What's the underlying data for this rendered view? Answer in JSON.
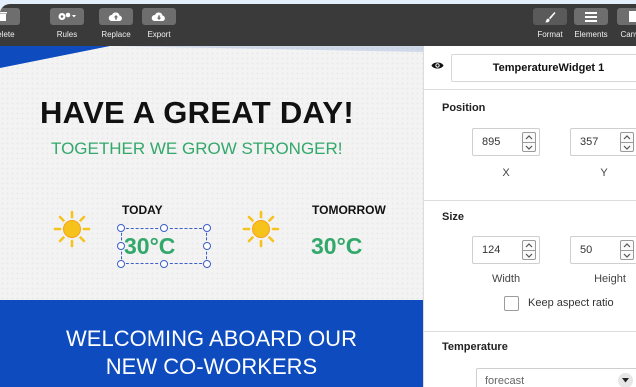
{
  "toolbar": {
    "left_buttons": [
      {
        "id": "delete",
        "label": "Delete",
        "icon": "trash-icon"
      },
      {
        "id": "rules",
        "label": "Rules",
        "icon": "gears-icon"
      },
      {
        "id": "replace",
        "label": "Replace",
        "icon": "cloud-upload-icon"
      },
      {
        "id": "export",
        "label": "Export",
        "icon": "cloud-download-icon"
      }
    ],
    "right_buttons": [
      {
        "id": "format",
        "label": "Format",
        "icon": "brush-icon"
      },
      {
        "id": "elements",
        "label": "Elements",
        "icon": "list-icon"
      },
      {
        "id": "canvas",
        "label": "Canvas",
        "icon": "canvas-icon"
      }
    ]
  },
  "canvas": {
    "headline": "HAVE A GREAT DAY!",
    "subline": "TOGETHER WE GROW STRONGER!",
    "today_label": "TODAY",
    "today_temp": "30°C",
    "tomorrow_label": "TOMORROW",
    "tomorrow_temp": "30°C",
    "banner_line1": "WELCOMING ABOARD OUR",
    "banner_line2": "NEW CO-WORKERS"
  },
  "panel": {
    "widget_name": "TemperatureWidget 1",
    "position_title": "Position",
    "x_value": "895",
    "x_label": "X",
    "y_value": "357",
    "y_label": "Y",
    "size_title": "Size",
    "width_value": "124",
    "width_label": "Width",
    "height_value": "50",
    "height_label": "Height",
    "aspect_label": "Keep aspect ratio",
    "temperature_title": "Temperature",
    "temperature_mode": "forecast"
  },
  "colors": {
    "toolbar_bg": "#3a3a3a",
    "accent_green": "#33a86b",
    "banner_blue": "#0d4bbf",
    "selection_blue": "#3c5fc8",
    "sun_yellow": "#f6c21c"
  }
}
